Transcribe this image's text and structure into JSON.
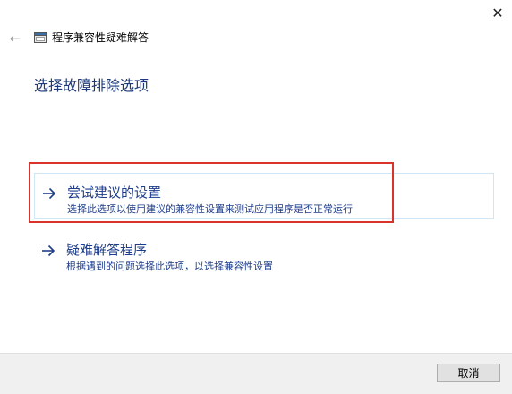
{
  "window": {
    "title": "程序兼容性疑难解答",
    "close_glyph": "✕",
    "back_glyph": "←"
  },
  "main": {
    "heading": "选择故障排除选项",
    "options": [
      {
        "title": "尝试建议的设置",
        "description": "选择此选项以使用建议的兼容性设置来测试应用程序是否正常运行"
      },
      {
        "title": "疑难解答程序",
        "description": "根据遇到的问题选择此选项，以选择兼容性设置"
      }
    ]
  },
  "footer": {
    "cancel_label": "取消"
  },
  "colors": {
    "link_blue": "#1f3d8a",
    "highlight_red": "#d9342b",
    "hover_border": "#cfe6f7",
    "footer_bg": "#f0f0f0"
  }
}
